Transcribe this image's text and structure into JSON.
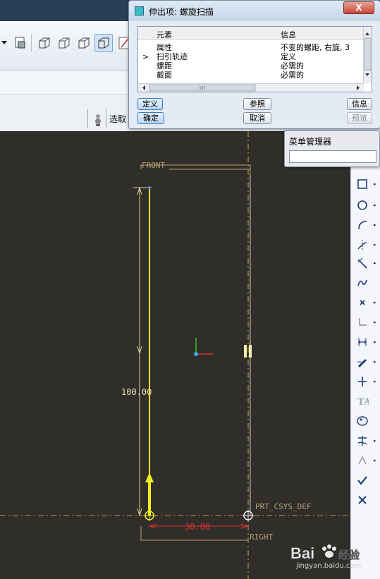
{
  "dialog": {
    "title": "伸出项: 螺旋扫描",
    "close": "X",
    "columns": {
      "element": "元素",
      "info": "信息"
    },
    "rows": [
      {
        "marker": "",
        "element": "属性",
        "info": "不变的螺距, 右旋, 3"
      },
      {
        "marker": ">",
        "element": "扫引轨迹",
        "info": "定义"
      },
      {
        "marker": "",
        "element": "螺距",
        "info": "必需的"
      },
      {
        "marker": "",
        "element": "截面",
        "info": "必需的"
      }
    ],
    "buttons": {
      "define": "定义",
      "reference": "参照",
      "info": "信息",
      "ok": "确定",
      "cancel": "取消",
      "preview": "预览"
    }
  },
  "menu_manager": {
    "title": "菜单管理器"
  },
  "toolbar": {
    "select": "选取"
  },
  "sketch": {
    "front_label": "FRONT",
    "right_label": "RIGHT",
    "csys_label": "PRT_CSYS_DEF",
    "dim_height": "100.00",
    "dim_width": "30.00"
  },
  "watermark": {
    "brand": "Bai",
    "brand2": "经验",
    "url": "jingyan.baidu.com"
  },
  "colors": {
    "sketch_yellow": "#e8e020",
    "dimension_red": "#e03030",
    "reference_tan": "#b8a070",
    "background": "#2f2e2a"
  }
}
